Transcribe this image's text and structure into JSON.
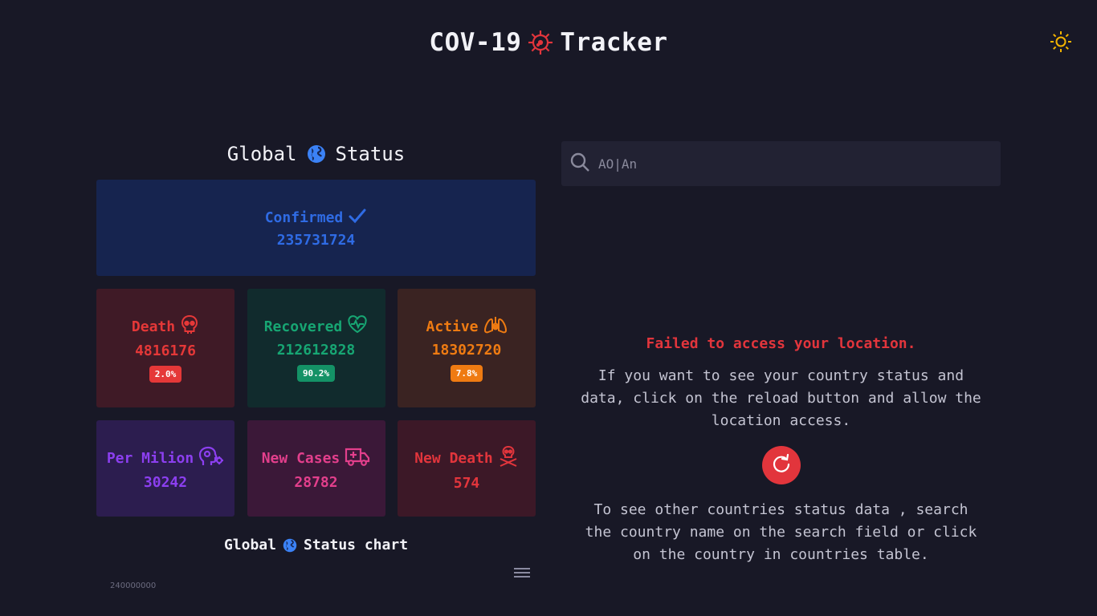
{
  "app": {
    "title_left": "COV-19",
    "title_right": "Tracker"
  },
  "global": {
    "title_left": "Global",
    "title_right": "Status",
    "confirmed": {
      "label": "Confirmed",
      "value": "235731724"
    },
    "death": {
      "label": "Death",
      "value": "4816176",
      "percent": "2.0%"
    },
    "recovered": {
      "label": "Recovered",
      "value": "212612828",
      "percent": "90.2%"
    },
    "active": {
      "label": "Active",
      "value": "18302720",
      "percent": "7.8%"
    },
    "per_million": {
      "label": "Per Milion",
      "value": "30242"
    },
    "new_cases": {
      "label": "New Cases",
      "value": "28782"
    },
    "new_death": {
      "label": "New Death",
      "value": "574"
    }
  },
  "chart": {
    "title_left": "Global",
    "title_right": "Status chart",
    "y_tick_top": "240000000"
  },
  "search": {
    "placeholder": "AO|An"
  },
  "location": {
    "error": "Failed to access your location.",
    "message": "If you want to see your country status and data, click on the reload button and allow the location access.",
    "hint": "To see other countries status data , search the country name on the search field or click on the country in countries table."
  },
  "icons": {
    "virus": "virus-icon",
    "theme": "sun-icon",
    "globe": "globe-icon",
    "check": "check-icon",
    "death": "skull-icon",
    "recovered": "heartbeat-icon",
    "active": "lungs-icon",
    "per_million": "head-virus-icon",
    "new_cases": "ambulance-icon",
    "new_death": "skull-crossbones-icon",
    "search": "search-icon",
    "reload": "reload-icon",
    "menu": "menu-icon"
  },
  "colors": {
    "background": "#181826",
    "confirmed": "#2f6be4",
    "death": "#e53838",
    "recovered": "#17a673",
    "active": "#ef7b12",
    "per_million": "#8c3ff0",
    "new_cases": "#e33f8c",
    "new_death": "#e2353c",
    "error": "#e2353c",
    "theme_icon": "#f4b400"
  }
}
